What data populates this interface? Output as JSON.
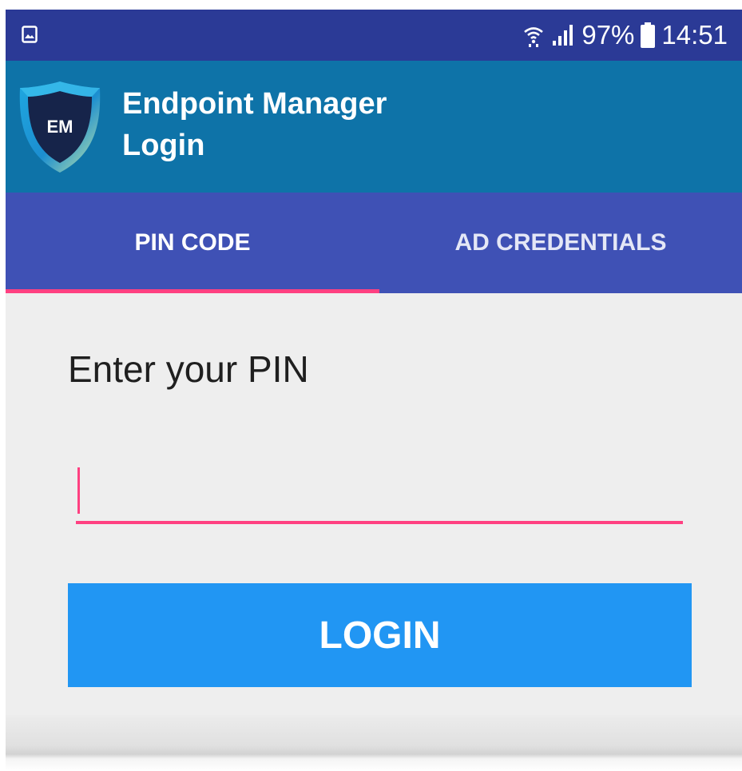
{
  "status_bar": {
    "left_icon": "image-notification-icon",
    "wifi_icon": "wifi-icon",
    "signal_icon": "signal-icon",
    "battery_percent": "97%",
    "battery_icon": "battery-icon",
    "time": "14:51"
  },
  "app_bar": {
    "logo_text": "EM",
    "title_line1": "Endpoint Manager",
    "title_line2": "Login"
  },
  "tabs": [
    {
      "label": "PIN CODE",
      "selected": true
    },
    {
      "label": "AD CREDENTIALS",
      "selected": false
    }
  ],
  "form": {
    "prompt": "Enter your PIN",
    "pin_value": "",
    "login_label": "LOGIN"
  },
  "colors": {
    "status_bar": "#2b3a96",
    "app_bar": "#0e73a8",
    "tab_bar": "#3f51b5",
    "accent": "#ff4081",
    "button": "#2196f3",
    "background": "#eeeeee"
  }
}
